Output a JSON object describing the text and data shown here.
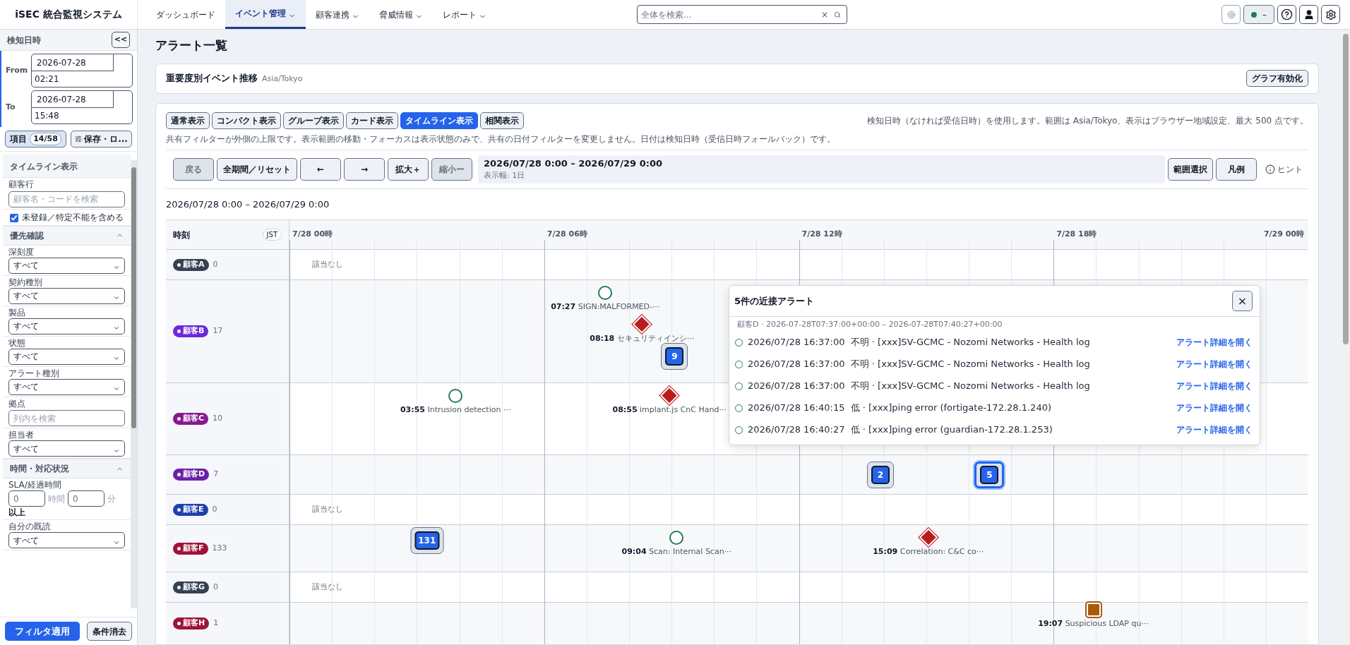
{
  "app_title": "iSEC 統合監視システム",
  "nav": [
    {
      "label": "ダッシュボード",
      "dropdown": false,
      "selected": false
    },
    {
      "label": "イベント管理",
      "dropdown": true,
      "selected": true
    },
    {
      "label": "顧客連携",
      "dropdown": true,
      "selected": false
    },
    {
      "label": "脅威情報",
      "dropdown": true,
      "selected": false
    },
    {
      "label": "レポート",
      "dropdown": true,
      "selected": false
    }
  ],
  "search": {
    "placeholder": "全体を検索...",
    "clear": "×"
  },
  "status": {
    "text": "–"
  },
  "sidebar": {
    "section_title": "検知日時",
    "collapse": "<<",
    "dates": [
      {
        "label": "From",
        "date": "2026-07-28",
        "time": "02:21"
      },
      {
        "label": "To",
        "date": "2026-07-28",
        "time": "15:48"
      }
    ],
    "items_button": {
      "label": "項目",
      "count": "14/58"
    },
    "save_button": "保存・ロ...",
    "filters": [
      {
        "kind": "header",
        "label": "タイムライン表示"
      },
      {
        "kind": "input",
        "label": "顧客行",
        "placeholder": "顧客名・コードを検索"
      },
      {
        "kind": "checkbox",
        "label": "未登録／特定不能を含める",
        "checked": true
      },
      {
        "kind": "section",
        "label": "優先確認",
        "expanded": true
      },
      {
        "kind": "select",
        "label": "深刻度",
        "value": "すべて"
      },
      {
        "kind": "select",
        "label": "契約種別",
        "value": "すべて"
      },
      {
        "kind": "select",
        "label": "製品",
        "value": "すべて"
      },
      {
        "kind": "select",
        "label": "状態",
        "value": "すべて"
      },
      {
        "kind": "select",
        "label": "アラート種別",
        "value": "すべて"
      },
      {
        "kind": "input",
        "label": "拠点",
        "placeholder": "列内を検索"
      },
      {
        "kind": "select",
        "label": "担当者",
        "value": "すべて"
      },
      {
        "kind": "section",
        "label": "時間・対応状況",
        "expanded": true
      },
      {
        "kind": "duration",
        "label": "SLA/経過時間",
        "hours": "0",
        "hours_unit": "時間",
        "minutes": "0",
        "minutes_unit": "分",
        "suffix": "以上"
      },
      {
        "kind": "select",
        "label": "自分の既読",
        "value": "すべて"
      }
    ],
    "apply_button": "フィルタ適用",
    "clear_button": "条件消去"
  },
  "page_title": "アラート一覧",
  "trend_card": {
    "title": "重要度別イベント推移",
    "timezone": "Asia/Tokyo",
    "button": "グラフ有効化"
  },
  "view_tabs": [
    {
      "label": "通常表示",
      "selected": false
    },
    {
      "label": "コンパクト表示",
      "selected": false
    },
    {
      "label": "グループ表示",
      "selected": false
    },
    {
      "label": "カード表示",
      "selected": false
    },
    {
      "label": "タイムライン表示",
      "selected": true
    },
    {
      "label": "相関表示",
      "selected": false
    }
  ],
  "view_note": "検知日時（なければ受信日時）を使用します。範囲は Asia/Tokyo、表示はブラウザー地域設定、最大 500 点です。",
  "filter_note": "共有フィルターが外側の上限です。表示範囲の移動・フォーカスは表示状態のみで、共有の日付フィルターを変更しません。日付は検知日時（受信日時フォールバック）です。",
  "toolbar": [
    {
      "label": "戻る",
      "disabled": true
    },
    {
      "label": "全期間／リセット",
      "disabled": false
    },
    {
      "label": "←",
      "disabled": false
    },
    {
      "label": "→",
      "disabled": false
    },
    {
      "label": "拡大＋",
      "disabled": false
    },
    {
      "label": "縮小ー",
      "disabled": true
    }
  ],
  "range": {
    "title": "2026/07/28 0:00 – 2026/07/29 0:00",
    "width": "表示幅: 1日"
  },
  "range_select": "範囲選択",
  "legend": "凡例",
  "hint": "ヒント",
  "range_heading": "2026/07/28 0:00 – 2026/07/29 0:00",
  "timeline": {
    "time_header": "時刻",
    "tz": "JST",
    "axis": [
      "7/28 00時",
      "7/28 06時",
      "7/28 12時",
      "7/28 18時",
      "7/29 00時"
    ],
    "rows": [
      {
        "customer": "顧客A",
        "color": "#374151",
        "count": "0",
        "empty": "該当なし",
        "events": []
      },
      {
        "customer": "顧客B",
        "color": "#6d28d9",
        "count": "17",
        "events": [
          {
            "kind": "circle",
            "time": "07:27",
            "text": "SIGN:MALFORMED-···"
          },
          {
            "kind": "diamond",
            "time": "08:18",
            "text": "セキュリティインシ···"
          },
          {
            "kind": "cluster",
            "count": "9",
            "selected": false
          }
        ]
      },
      {
        "customer": "顧客C",
        "color": "#86198f",
        "count": "10",
        "events": [
          {
            "kind": "circle",
            "time": "03:55",
            "text": "Intrusion detection ···"
          },
          {
            "kind": "diamond",
            "time": "08:55",
            "text": "implant.js CnC Hand···"
          }
        ]
      },
      {
        "customer": "顧客D",
        "color": "#6b21a8",
        "count": "7",
        "events": [
          {
            "kind": "cluster",
            "count": "2",
            "selected": false
          },
          {
            "kind": "cluster",
            "count": "5",
            "selected": true
          }
        ]
      },
      {
        "customer": "顧客E",
        "color": "#1e40af",
        "count": "0",
        "empty": "該当なし",
        "events": []
      },
      {
        "customer": "顧客F",
        "color": "#9f1239",
        "count": "133",
        "events": [
          {
            "kind": "cluster",
            "count": "131",
            "selected": false
          },
          {
            "kind": "circle",
            "time": "09:04",
            "text": "Scan: Internal Scan···"
          },
          {
            "kind": "diamond",
            "time": "15:09",
            "text": "Correlation: C&C co···"
          }
        ]
      },
      {
        "customer": "顧客G",
        "color": "#334155",
        "count": "0",
        "empty": "該当なし",
        "events": []
      },
      {
        "customer": "顧客H",
        "color": "#9f1239",
        "count": "1",
        "events": [
          {
            "kind": "square",
            "time": "19:07",
            "text": "Suspicious LDAP qu···"
          }
        ]
      }
    ]
  },
  "popup": {
    "title": "5件の近接アラート",
    "close": "×",
    "subtitle": "顧客D · 2026-07-28T07:37:00+00:00 – 2026-07-28T07:40:27+00:00",
    "alerts": [
      {
        "time": "2026/07/28 16:37:00",
        "text": "不明 · [xxx]SV-GCMC - Nozomi Networks - Health log",
        "link": "アラート詳細を開く"
      },
      {
        "time": "2026/07/28 16:37:00",
        "text": "不明 · [xxx]SV-GCMC - Nozomi Networks - Health log",
        "link": "アラート詳細を開く"
      },
      {
        "time": "2026/07/28 16:37:00",
        "text": "不明 · [xxx]SV-GCMC - Nozomi Networks - Health log",
        "link": "アラート詳細を開く"
      },
      {
        "time": "2026/07/28 16:40:15",
        "text": "低 · [xxx]ping error (fortigate-172.28.1.240)",
        "link": "アラート詳細を開く"
      },
      {
        "time": "2026/07/28 16:40:27",
        "text": "低 · [xxx]ping error (guardian-172.28.1.253)",
        "link": "アラート詳細を開く"
      }
    ]
  }
}
